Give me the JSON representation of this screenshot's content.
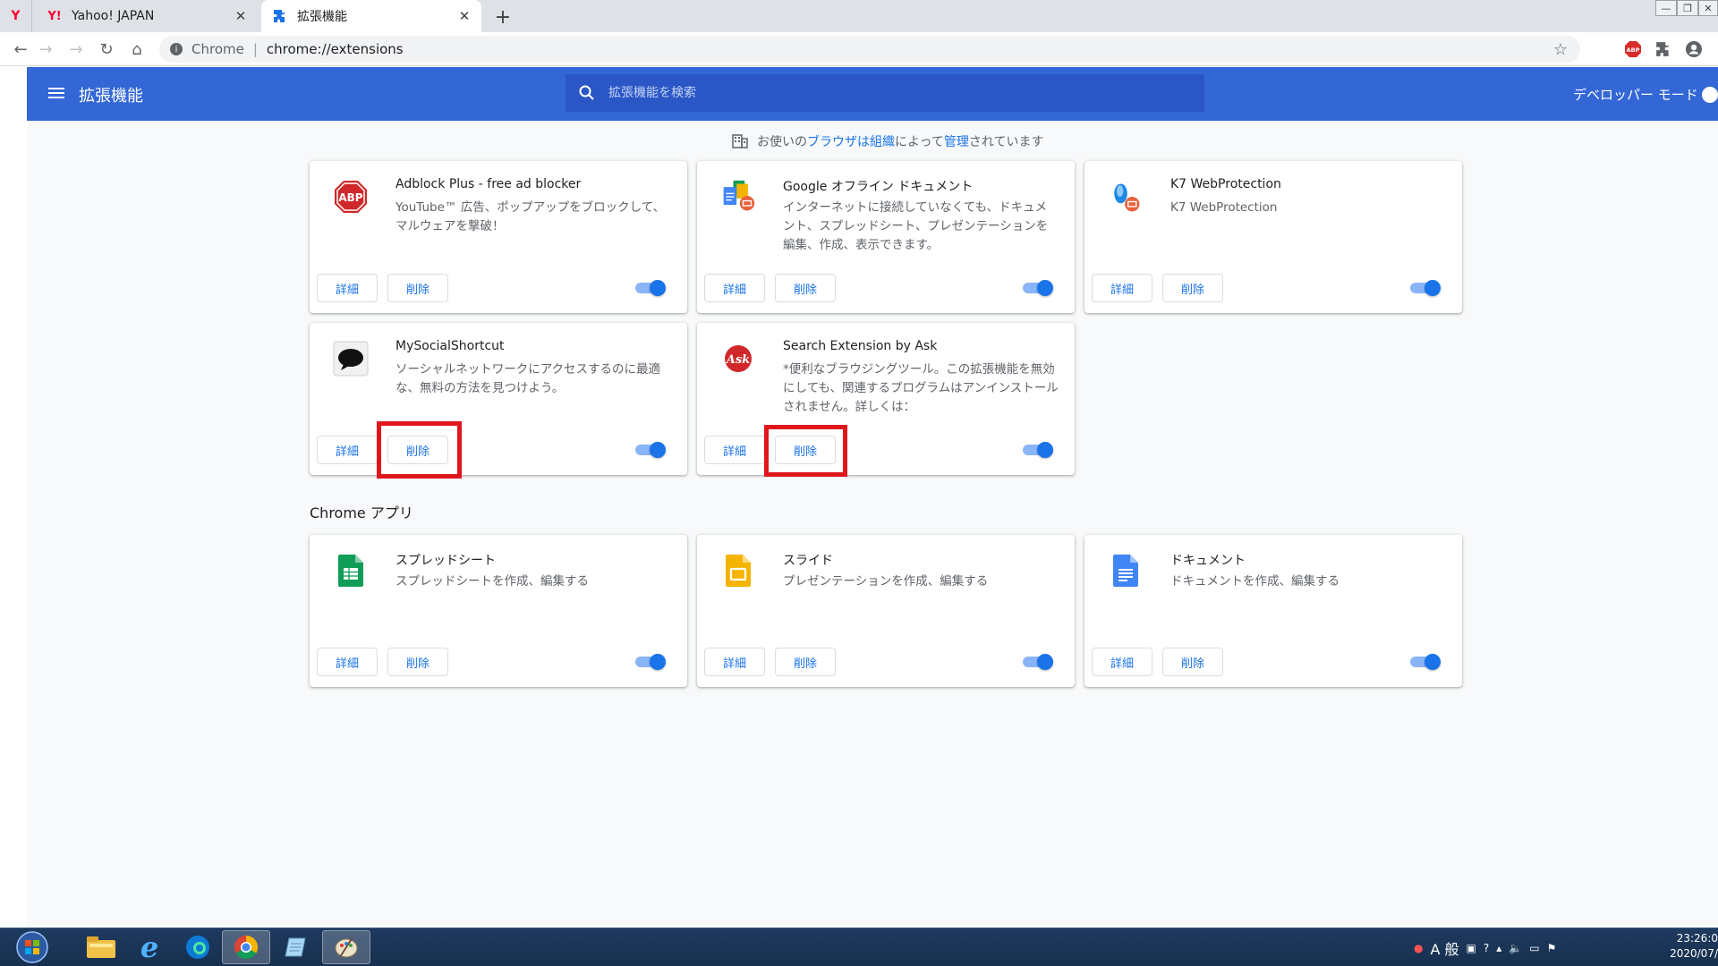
{
  "browser": {
    "tabs": [
      {
        "title": "Yahoo! JAPAN",
        "icon": "yahoo-icon",
        "active": false
      },
      {
        "title": "拡張機能",
        "icon": "puzzle-icon",
        "active": true
      }
    ],
    "address": {
      "site": "Chrome",
      "separator": "|",
      "url": "chrome://extensions"
    }
  },
  "header": {
    "title": "拡張機能",
    "search_placeholder": "拡張機能を検索",
    "dev_mode_label": "デベロッパー モード",
    "dev_mode_on": false
  },
  "managed_notice": {
    "prefix": "お使いの",
    "link1": "ブラウザは組織",
    "middle": "によって",
    "link2": "管理",
    "suffix": "されています"
  },
  "buttons": {
    "details": "詳細",
    "remove": "削除"
  },
  "extensions": [
    {
      "name": "Adblock Plus - free ad blocker",
      "description": "YouTube™ 広告、ポップアップをブロックして、マルウェアを撃破！",
      "icon": "abp-icon",
      "enabled": true
    },
    {
      "name": "Google オフライン ドキュメント",
      "description": "インターネットに接続していなくても、ドキュメント、スプレッドシート、プレゼンテーションを編集、作成、表示できます。",
      "icon": "google-docs-offline-icon",
      "enabled": true
    },
    {
      "name": "K7 WebProtection",
      "description": "K7 WebProtection",
      "icon": "k7-icon",
      "enabled": true
    },
    {
      "name": "MySocialShortcut",
      "description": "ソーシャルネットワークにアクセスするのに最適な、無料の方法を見つけよう。",
      "icon": "speech-bubble-icon",
      "enabled": true
    },
    {
      "name": "Search Extension by Ask",
      "description": "*便利なブラウジングツール。この拡張機能を無効にしても、関連するプログラムはアンインストールされません。詳しくは：",
      "icon": "ask-icon",
      "enabled": true
    }
  ],
  "apps_section_title": "Chrome アプリ",
  "apps": [
    {
      "name": "スプレッドシート",
      "description": "スプレッドシートを作成、編集する",
      "icon": "sheets-icon",
      "enabled": true
    },
    {
      "name": "スライド",
      "description": "プレゼンテーションを作成、編集する",
      "icon": "slides-icon",
      "enabled": true
    },
    {
      "name": "ドキュメント",
      "description": "ドキュメントを作成、編集する",
      "icon": "docs-icon",
      "enabled": true
    }
  ],
  "taskbar": {
    "clock_time": "23:26:0",
    "clock_date": "2020/07/",
    "ime_label": "A 般"
  },
  "colors": {
    "header": "#3367d6",
    "accent": "#1a73e8",
    "highlight": "#e0161d"
  }
}
